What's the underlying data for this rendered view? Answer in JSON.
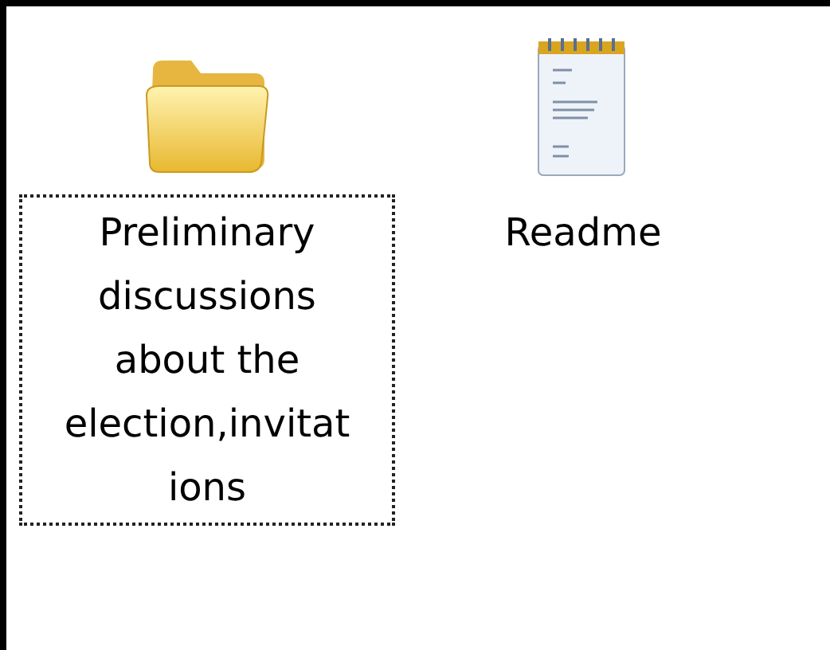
{
  "items": [
    {
      "kind": "folder",
      "label_lines": [
        "Preliminary",
        "discussions",
        "about the",
        "election,invitat",
        "ions"
      ],
      "focused": true
    },
    {
      "kind": "text-document",
      "label_lines": [
        "Readme"
      ],
      "focused": false
    }
  ]
}
